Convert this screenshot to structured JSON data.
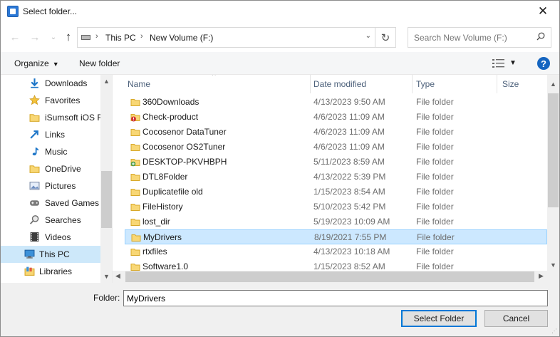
{
  "window": {
    "title": "Select folder..."
  },
  "address": {
    "crumbs": [
      "This PC",
      "New Volume (F:)"
    ]
  },
  "search": {
    "placeholder": "Search New Volume (F:)"
  },
  "toolbar": {
    "organize_label": "Organize",
    "new_folder_label": "New folder",
    "help_label": "?"
  },
  "nav_items": [
    {
      "label": "Downloads",
      "icon": "downloads-icon"
    },
    {
      "label": "Favorites",
      "icon": "star-icon"
    },
    {
      "label": "iSumsoft iOS R",
      "icon": "folder-icon"
    },
    {
      "label": "Links",
      "icon": "link-icon"
    },
    {
      "label": "Music",
      "icon": "music-icon"
    },
    {
      "label": "OneDrive",
      "icon": "folder-icon"
    },
    {
      "label": "Pictures",
      "icon": "pictures-icon"
    },
    {
      "label": "Saved Games",
      "icon": "saved-games-icon"
    },
    {
      "label": "Searches",
      "icon": "search-icon"
    },
    {
      "label": "Videos",
      "icon": "videos-icon"
    },
    {
      "label": "This PC",
      "icon": "computer-icon",
      "selected": true
    },
    {
      "label": "Libraries",
      "icon": "libraries-icon"
    }
  ],
  "columns": {
    "name": "Name",
    "date": "Date modified",
    "type": "Type",
    "size": "Size"
  },
  "files": [
    {
      "name": "360Downloads",
      "date": "4/13/2023 9:50 AM",
      "type": "File folder",
      "icon": "folder-icon"
    },
    {
      "name": "Check-product",
      "date": "4/6/2023 11:09 AM",
      "type": "File folder",
      "icon": "folder-warning-icon"
    },
    {
      "name": "Cocosenor DataTuner",
      "date": "4/6/2023 11:09 AM",
      "type": "File folder",
      "icon": "folder-icon"
    },
    {
      "name": "Cocosenor OS2Tuner",
      "date": "4/6/2023 11:09 AM",
      "type": "File folder",
      "icon": "folder-icon"
    },
    {
      "name": "DESKTOP-PKVHBPH",
      "date": "5/11/2023 8:59 AM",
      "type": "File folder",
      "icon": "network-folder-icon"
    },
    {
      "name": "DTL8Folder",
      "date": "4/13/2022 5:39 PM",
      "type": "File folder",
      "icon": "folder-icon"
    },
    {
      "name": "Duplicatefile old",
      "date": "1/15/2023 8:54 AM",
      "type": "File folder",
      "icon": "folder-icon"
    },
    {
      "name": "FileHistory",
      "date": "5/10/2023 5:42 PM",
      "type": "File folder",
      "icon": "folder-icon"
    },
    {
      "name": "lost_dir",
      "date": "5/19/2023 10:09 AM",
      "type": "File folder",
      "icon": "folder-icon"
    },
    {
      "name": "MyDrivers",
      "date": "8/19/2021 7:55 PM",
      "type": "File folder",
      "icon": "folder-icon",
      "selected": true
    },
    {
      "name": "rtxfiles",
      "date": "4/13/2023 10:18 AM",
      "type": "File folder",
      "icon": "folder-icon"
    },
    {
      "name": "Software1.0",
      "date": "1/15/2023 8:52 AM",
      "type": "File folder",
      "icon": "folder-icon"
    }
  ],
  "footer": {
    "folder_label": "Folder:",
    "folder_value": "MyDrivers",
    "select_label": "Select Folder",
    "cancel_label": "Cancel"
  },
  "colors": {
    "selection": "#cce8ff",
    "accent": "#0078d7",
    "folder": "#f8d775"
  }
}
